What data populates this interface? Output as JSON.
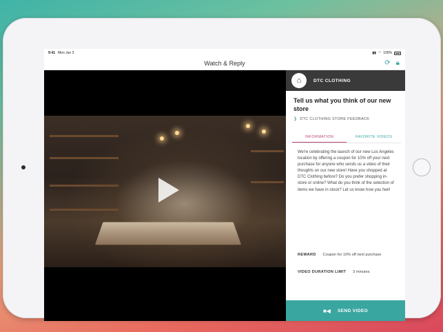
{
  "status": {
    "time": "9:41",
    "date": "Mon Jun 3",
    "battery": "100%"
  },
  "nav": {
    "title": "Watch & Reply",
    "refresh_icon": "refresh-icon",
    "lock_icon": "lock-icon"
  },
  "brand": {
    "name": "DTC CLOTHING",
    "logo_icon": "hanger-icon"
  },
  "campaign": {
    "title": "Tell us what you think of our new store",
    "subtitle": "DTC CLOTHING STORE FEEDBACK",
    "tabs": [
      {
        "label": "INFORMATION",
        "active": true
      },
      {
        "label": "FAVORITE VIDEOS",
        "active": false
      }
    ],
    "description": "We're celebrating the launch of our new Los Angeles location by offering a coupon for 10% off your next purchase for anyone who sends us a video of their thoughts on our new store! Have you shopped at DTC Clothing before? Do you prefer shopping in-store or online? What do you think of the selection of items we have in stock? Let us know how you feel!",
    "reward_label": "REWARD",
    "reward_value": "Coupon for 10% off next purchase",
    "duration_label": "VIDEO DURATION LIMIT",
    "duration_value": "3 minutes"
  },
  "action": {
    "label": "SEND VIDEO",
    "icon": "video-camera-icon"
  },
  "colors": {
    "accent": "#3aa6a0",
    "tab_active": "#b6477a",
    "header": "#3a3a3a"
  }
}
